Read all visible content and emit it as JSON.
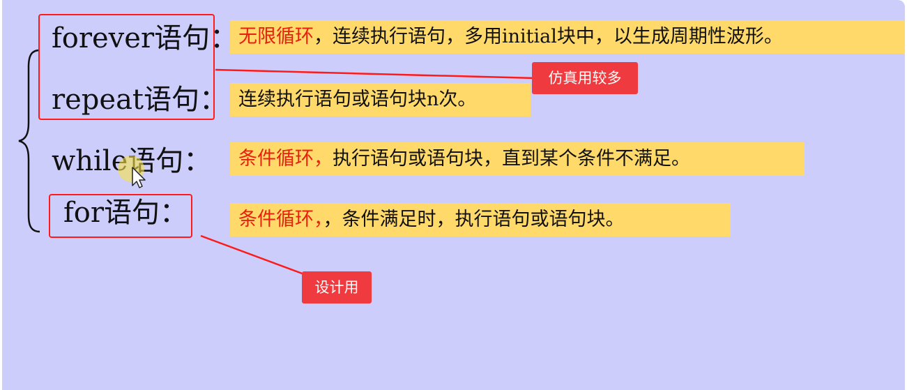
{
  "rows": [
    {
      "keyword": "forever",
      "suffix": "语句：",
      "desc_highlight": "无限循环",
      "desc_rest": "，连续执行语句，多用initial块中，以生成周期性波形。"
    },
    {
      "keyword": "repeat",
      "suffix": "语句：",
      "desc_highlight": "",
      "desc_rest": "连续执行语句或语句块n次。"
    },
    {
      "keyword": "while",
      "suffix": "语句：",
      "desc_highlight": "条件循环，",
      "desc_rest": "执行语句或语句块，直到某个条件不满足。"
    },
    {
      "keyword": "for",
      "suffix": "语句：",
      "desc_highlight": "条件循环，",
      "desc_rest": "，条件满足时，执行语句或语句块。"
    }
  ],
  "callouts": {
    "simulation": "仿真用较多",
    "design": "设计用"
  },
  "colors": {
    "background": "#cccdfb",
    "highlight_box": "#ffd96a",
    "highlight_text": "#e8200f",
    "annotation_red": "#ff1a1a",
    "callout_bg": "#ef3b3f"
  }
}
